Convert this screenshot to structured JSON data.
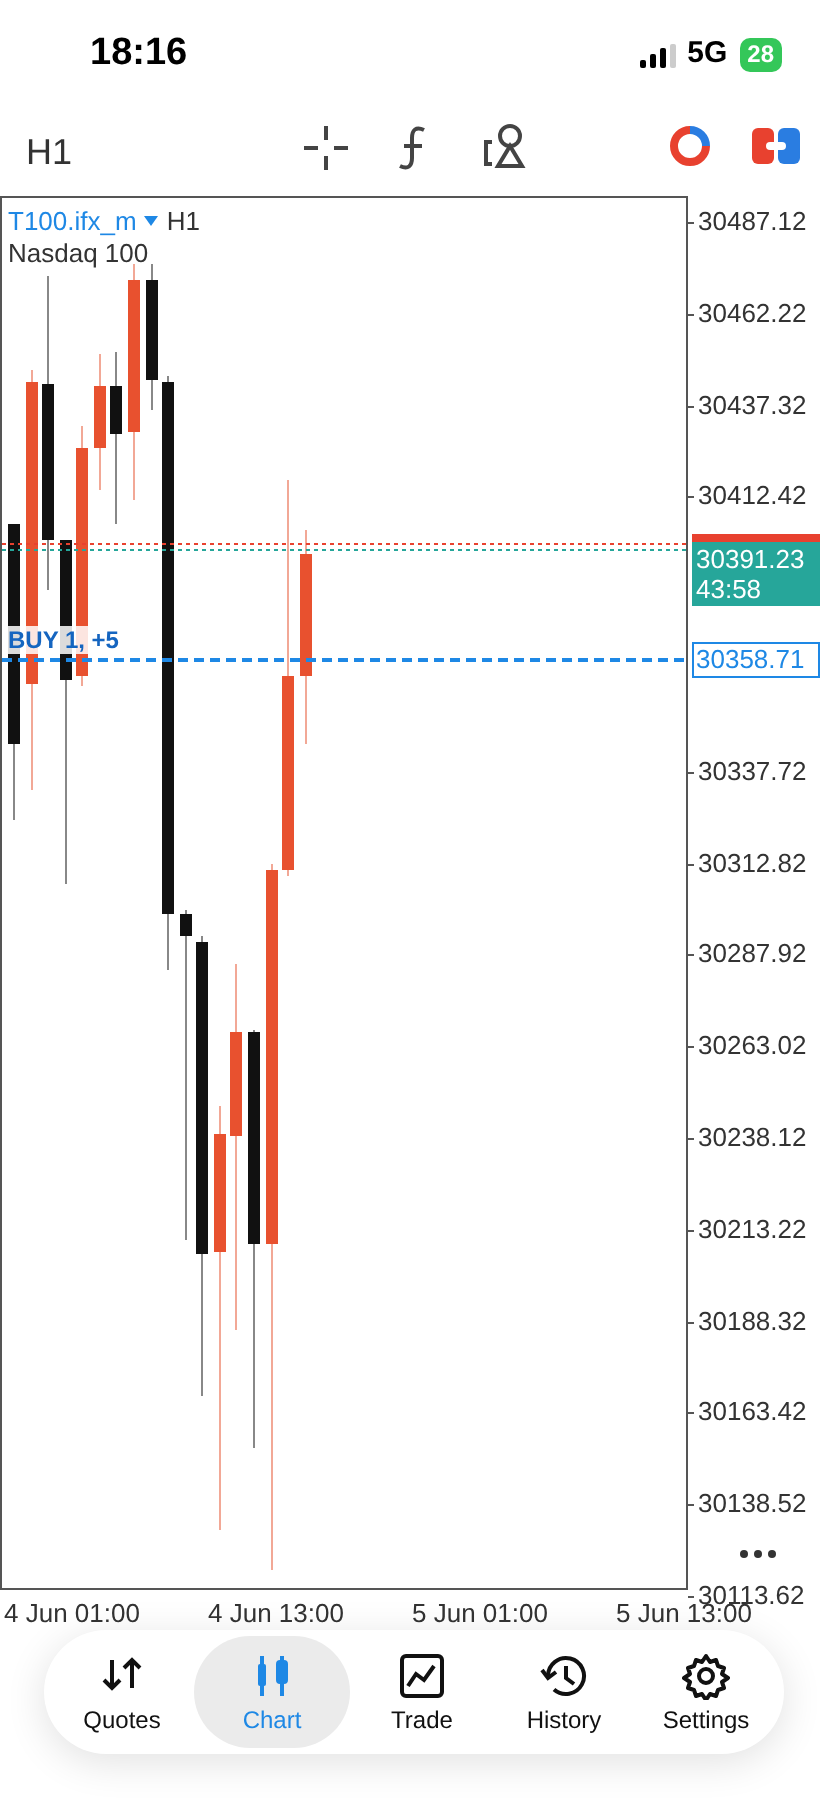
{
  "status_bar": {
    "time": "18:16",
    "network": "5G",
    "battery": "28"
  },
  "toolbar": {
    "timeframe": "H1"
  },
  "chart": {
    "symbol": "T100.ifx_m",
    "symbol_timeframe": "H1",
    "description": "Nasdaq 100",
    "price_ticks": [
      "30487.12",
      "30462.22",
      "30437.32",
      "30412.42",
      "30337.72",
      "30312.82",
      "30287.92",
      "30263.02",
      "30238.12",
      "30213.22",
      "30188.32",
      "30163.42",
      "30138.52",
      "30113.62"
    ],
    "bid_label": "30391.23",
    "countdown": "43:58",
    "position_label": "BUY 1, +5",
    "position_price": "30358.71",
    "time_ticks": [
      "4 Jun 01:00",
      "4 Jun 13:00",
      "5 Jun 01:00",
      "5 Jun 13:00"
    ]
  },
  "nav": [
    {
      "label": "Quotes",
      "selected": false
    },
    {
      "label": "Chart",
      "selected": true
    },
    {
      "label": "Trade",
      "selected": false
    },
    {
      "label": "History",
      "selected": false
    },
    {
      "label": "Settings",
      "selected": false
    }
  ]
}
